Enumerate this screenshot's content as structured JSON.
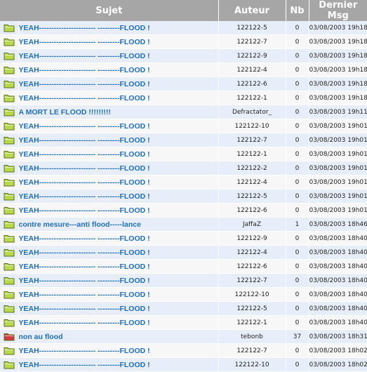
{
  "header": {
    "subject": "Sujet",
    "author": "Auteur",
    "count": "Nb",
    "last_msg": "Dernier Msg"
  },
  "folder_colors": {
    "normal": "#b8d94a",
    "hot": "#d23b3b"
  },
  "rows": [
    {
      "icon": "folder-icon",
      "subject": "YEAH----------------------- ---------FLOOD !",
      "author": "122122-5",
      "nb": "0",
      "date": "03/08/2003 19h18"
    },
    {
      "icon": "folder-icon",
      "subject": "YEAH----------------------- ---------FLOOD !",
      "author": "122122-7",
      "nb": "0",
      "date": "03/08/2003 19h18"
    },
    {
      "icon": "folder-icon",
      "subject": "YEAH----------------------- ---------FLOOD !",
      "author": "122122-9",
      "nb": "0",
      "date": "03/08/2003 19h18"
    },
    {
      "icon": "folder-icon",
      "subject": "YEAH----------------------- ---------FLOOD !",
      "author": "122122-4",
      "nb": "0",
      "date": "03/08/2003 19h18"
    },
    {
      "icon": "folder-icon",
      "subject": "YEAH----------------------- ---------FLOOD !",
      "author": "122122-6",
      "nb": "0",
      "date": "03/08/2003 19h18"
    },
    {
      "icon": "folder-icon",
      "subject": "YEAH----------------------- ---------FLOOD !",
      "author": "122122-1",
      "nb": "0",
      "date": "03/08/2003 19h18"
    },
    {
      "icon": "folder-icon",
      "subject": "A MORT LE FLOOD !!!!!!!!!",
      "author": "Defractator_",
      "nb": "0",
      "date": "03/08/2003 19h11"
    },
    {
      "icon": "folder-icon",
      "subject": "YEAH----------------------- ---------FLOOD !",
      "author": "122122-10",
      "nb": "0",
      "date": "03/08/2003 19h01"
    },
    {
      "icon": "folder-icon",
      "subject": "YEAH----------------------- ---------FLOOD !",
      "author": "122122-7",
      "nb": "0",
      "date": "03/08/2003 19h01"
    },
    {
      "icon": "folder-icon",
      "subject": "YEAH----------------------- ---------FLOOD !",
      "author": "122122-1",
      "nb": "0",
      "date": "03/08/2003 19h01"
    },
    {
      "icon": "folder-icon",
      "subject": "YEAH----------------------- ---------FLOOD !",
      "author": "122122-2",
      "nb": "0",
      "date": "03/08/2003 19h01"
    },
    {
      "icon": "folder-icon",
      "subject": "YEAH----------------------- ---------FLOOD !",
      "author": "122122-4",
      "nb": "0",
      "date": "03/08/2003 19h01"
    },
    {
      "icon": "folder-icon",
      "subject": "YEAH----------------------- ---------FLOOD !",
      "author": "122122-5",
      "nb": "0",
      "date": "03/08/2003 19h01"
    },
    {
      "icon": "folder-icon",
      "subject": "YEAH----------------------- ---------FLOOD !",
      "author": "122122-6",
      "nb": "0",
      "date": "03/08/2003 19h01"
    },
    {
      "icon": "folder-icon",
      "subject": "contre mesure---anti flood-----lance",
      "author": "JaffaZ",
      "nb": "1",
      "date": "03/08/2003 18h46"
    },
    {
      "icon": "folder-icon",
      "subject": "YEAH----------------------- ---------FLOOD !",
      "author": "122122-9",
      "nb": "0",
      "date": "03/08/2003 18h40"
    },
    {
      "icon": "folder-icon",
      "subject": "YEAH----------------------- ---------FLOOD !",
      "author": "122122-4",
      "nb": "0",
      "date": "03/08/2003 18h40"
    },
    {
      "icon": "folder-icon",
      "subject": "YEAH----------------------- ---------FLOOD !",
      "author": "122122-6",
      "nb": "0",
      "date": "03/08/2003 18h40"
    },
    {
      "icon": "folder-icon",
      "subject": "YEAH----------------------- ---------FLOOD !",
      "author": "122122-7",
      "nb": "0",
      "date": "03/08/2003 18h40"
    },
    {
      "icon": "folder-icon",
      "subject": "YEAH----------------------- ---------FLOOD !",
      "author": "122122-10",
      "nb": "0",
      "date": "03/08/2003 18h40"
    },
    {
      "icon": "folder-icon",
      "subject": "YEAH----------------------- ---------FLOOD !",
      "author": "122122-5",
      "nb": "0",
      "date": "03/08/2003 18h40"
    },
    {
      "icon": "folder-icon",
      "subject": "YEAH----------------------- ---------FLOOD !",
      "author": "122122-1",
      "nb": "0",
      "date": "03/08/2003 18h40"
    },
    {
      "icon": "hot-folder-icon",
      "subject": "non au flood",
      "author": "tebonb",
      "nb": "37",
      "date": "03/08/2003 18h31"
    },
    {
      "icon": "folder-icon",
      "subject": "YEAH----------------------- ---------FLOOD !",
      "author": "122122-7",
      "nb": "0",
      "date": "03/08/2003 18h02"
    },
    {
      "icon": "folder-icon",
      "subject": "YEAH----------------------- ---------FLOOD !",
      "author": "122122-10",
      "nb": "0",
      "date": "03/08/2003 18h02"
    }
  ]
}
